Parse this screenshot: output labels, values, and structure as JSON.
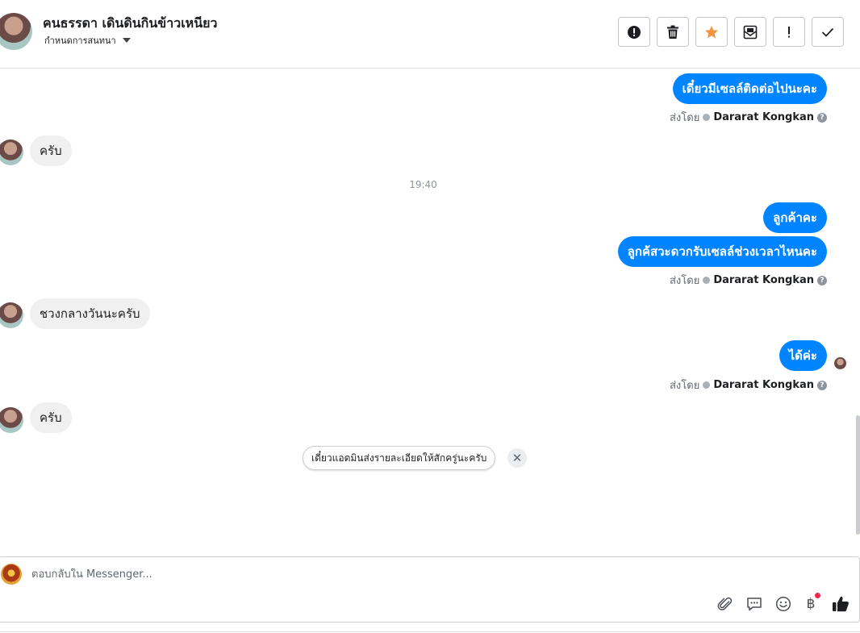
{
  "header": {
    "contact_name": "คนธรรดา เดินดินกินข้าวเหนียว",
    "subtitle": "กำหนดการสนทนา",
    "actions": [
      {
        "name": "report-spam-button",
        "icon": "alert-circle-icon"
      },
      {
        "name": "delete-button",
        "icon": "trash-icon"
      },
      {
        "name": "star-button",
        "icon": "star-icon"
      },
      {
        "name": "mark-unread-button",
        "icon": "envelope-icon"
      },
      {
        "name": "follow-up-button",
        "icon": "exclamation-icon"
      },
      {
        "name": "mark-done-button",
        "icon": "checkmark-icon"
      }
    ]
  },
  "messages": {
    "out1": "เดี๋ยวมีเซลล์ติดต่อไปนะคะ",
    "in1": "ครับ",
    "time1": "19:40",
    "out2": "ลูกค้าคะ",
    "out3": "ลูกค้สวะดวกรับเซลล์ช่วงเวลาไหนคะ",
    "in2": "ชวงกลางวันนะครับ",
    "out4": "ได้ค่ะ",
    "in3": "ครับ"
  },
  "sender": {
    "prefix": "ส่งโดย",
    "name": "Dararat Kongkan",
    "help": "?"
  },
  "suggestion": {
    "text": "เดี๋ยวแอดมินส่งรายละเอียดให้สักครู่นะครับ",
    "close": "✕"
  },
  "composer": {
    "placeholder": "ตอบกลับใน Messenger...",
    "currency_symbol": "฿",
    "tools": [
      "paperclip-icon",
      "saved-reply-icon",
      "emoji-icon",
      "baht-payment-icon",
      "thumbs-up-icon"
    ]
  },
  "colors": {
    "accent": "#0084ff",
    "incoming_bubble": "#f1f0f0",
    "star": "#f5923e",
    "notification": "#f02849"
  }
}
